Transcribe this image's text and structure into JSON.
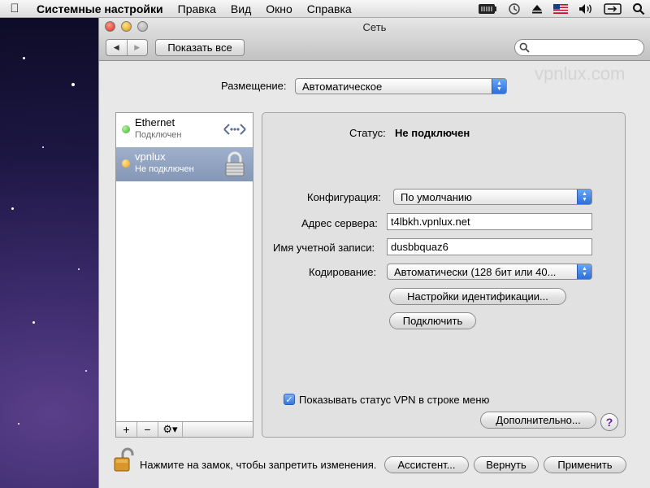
{
  "menubar": {
    "apple": "",
    "items": [
      "Системные настройки",
      "Правка",
      "Вид",
      "Окно",
      "Справка"
    ],
    "icons": [
      "battery-icon",
      "time-machine-icon",
      "eject-icon",
      "flag-us-icon",
      "volume-icon",
      "screen-icon",
      "spotlight-icon"
    ]
  },
  "window": {
    "title": "Сеть",
    "show_all": "Показать все",
    "watermark": "vpnlux.com",
    "location_label": "Размещение:",
    "location_value": "Автоматическое"
  },
  "sidebar": {
    "items": [
      {
        "name": "Ethernet",
        "status": "Подключен",
        "dot_color": "#3cb022",
        "icon": "ethernet-icon"
      },
      {
        "name": "vpnlux",
        "status": "Не подключен",
        "dot_color": "#f0a30a",
        "icon": "lock-icon"
      }
    ],
    "add": "+",
    "remove": "−",
    "gear": "⚙▾"
  },
  "detail": {
    "status_label": "Статус:",
    "status_value": "Не подключен",
    "config_label": "Конфигурация:",
    "config_value": "По умолчанию",
    "server_label": "Адрес сервера:",
    "server_value": "t4lbkh.vpnlux.net",
    "account_label": "Имя учетной записи:",
    "account_value": "dusbbquaz6",
    "encryption_label": "Кодирование:",
    "encryption_value": "Автоматически (128 бит или 40...",
    "auth_button": "Настройки идентификации...",
    "connect_button": "Подключить",
    "vpn_status_check": "Показывать статус VPN в строке меню",
    "vpn_status_checked": true,
    "advanced_button": "Дополнительно...",
    "help": "?"
  },
  "footer": {
    "lock_text": "Нажмите на замок, чтобы запретить изменения.",
    "assistant_button": "Ассистент...",
    "revert_button": "Вернуть",
    "apply_button": "Применить"
  }
}
